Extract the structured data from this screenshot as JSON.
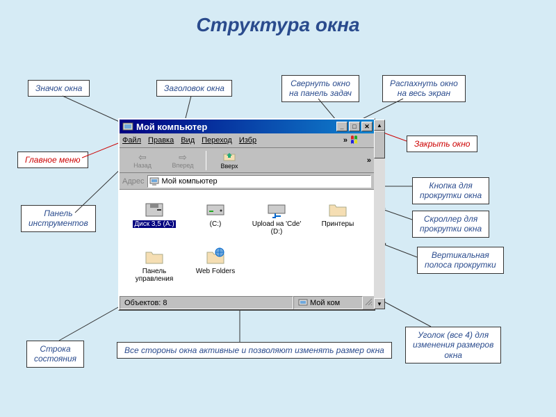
{
  "page_title": "Структура окна",
  "callouts": {
    "window_icon": "Значок окна",
    "window_title": "Заголовок окна",
    "minimize": "Свернуть окно\nна панель задач",
    "maximize": "Распахнуть окно\nна весь экран",
    "close": "Закрыть окно",
    "main_menu": "Главное меню",
    "toolbar": "Панель\nинструментов",
    "scroll_button": "Кнопка для\nпрокрутки окна",
    "scroller": "Скроллер для\nпрокрутки окна",
    "vscrollbar": "Вертикальная\nполоса прокрутки",
    "statusbar": "Строка\nсостояния",
    "resize_sides": "Все стороны окна активные и позволяют изменять размер окна",
    "resize_corner": "Уголок  (все 4) для\nизменения размеров\nокна"
  },
  "window": {
    "title": "Мой компьютер",
    "menu": {
      "file": "Файл",
      "edit": "Правка",
      "view": "Вид",
      "go": "Переход",
      "fav": "Избр",
      "chevron": "»"
    },
    "toolbar": {
      "back": "Назад",
      "forward": "Вперед",
      "up": "Вверх",
      "chevron": "»"
    },
    "address": {
      "label": "Адрес",
      "value": "Мой компьютер"
    },
    "items": [
      {
        "label": "Диск 3,5 (A:)",
        "icon": "floppy",
        "selected": true
      },
      {
        "label": "(C:)",
        "icon": "hdd",
        "selected": false
      },
      {
        "label": "Upload на 'Cde' (D:)",
        "icon": "netdrive",
        "selected": false
      },
      {
        "label": "Принтеры",
        "icon": "folder",
        "selected": false
      },
      {
        "label": "Панель управления",
        "icon": "folder",
        "selected": false
      },
      {
        "label": "Web Folders",
        "icon": "webfolder",
        "selected": false
      }
    ],
    "status": {
      "objects": "Объектов: 8",
      "location": "Мой ком"
    }
  }
}
